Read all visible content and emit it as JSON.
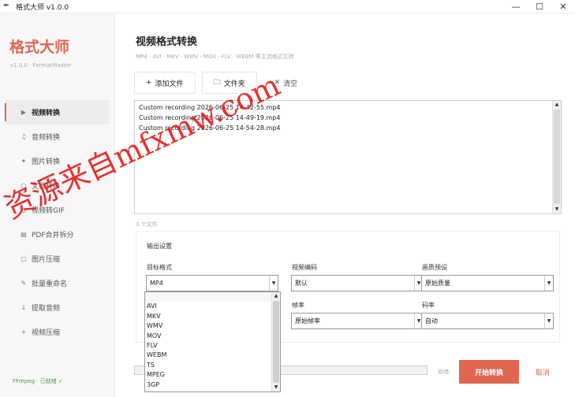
{
  "window": {
    "title": "格式大师 v1.0.0",
    "controls": [
      "—",
      "☐",
      "✕"
    ]
  },
  "sidebar": {
    "brand": "格式大师",
    "version": "v1.0.0 · FormatMaster",
    "items": [
      {
        "icon": "▶",
        "label": "视频转换"
      },
      {
        "icon": "♫",
        "label": "音频转换"
      },
      {
        "icon": "✦",
        "label": "图片转换"
      },
      {
        "icon": "○",
        "label": "文档转换"
      },
      {
        "icon": "◎",
        "label": "视频转GIF"
      },
      {
        "icon": "▤",
        "label": "PDF合并拆分"
      },
      {
        "icon": "▢",
        "label": "图片压缩"
      },
      {
        "icon": "✎",
        "label": "批量重命名"
      },
      {
        "icon": "↓",
        "label": "提取音频"
      },
      {
        "icon": "+",
        "label": "视频压缩"
      }
    ],
    "ffmpeg_status": "FFmpeg · 已就绪 ✓"
  },
  "main": {
    "title": "视频格式转换",
    "subtitle": "MP4 · AVI · MKV · WMV · MOV · FLV · WEBM 等主流格式互转",
    "toolbar": {
      "add_file": "添加文件",
      "add_file_icon": "+",
      "folder": "文件夹",
      "folder_icon": "🗀",
      "clear": "清空",
      "clear_icon": "✕"
    },
    "files": [
      "Custom recording 2026-06-25 14-42-55.mp4",
      "Custom recording 2026-06-25 14-49-19.mp4",
      "Custom recording 2026-06-25 14-54-28.mp4"
    ],
    "file_count": "3 个文件",
    "settings": {
      "title": "输出设置",
      "target_format_label": "目标格式",
      "target_format_value": "MP4",
      "video_codec_label": "视频编码",
      "video_codec_value": "默认",
      "quality_label": "画质预设",
      "quality_value": "原始质量",
      "framerate_label": "帧率",
      "framerate_value": "原始帧率",
      "bitrate_label": "码率",
      "bitrate_value": "自动"
    },
    "format_options": [
      "",
      "AVI",
      "MKV",
      "WMV",
      "MOV",
      "FLV",
      "WEBM",
      "TS",
      "MPEG",
      "3GP"
    ],
    "progress": 0.0,
    "status_text": "就绪",
    "start_button": "开始转换",
    "cancel_button": "取消"
  },
  "watermark": "资源来自mfxmw.com"
}
